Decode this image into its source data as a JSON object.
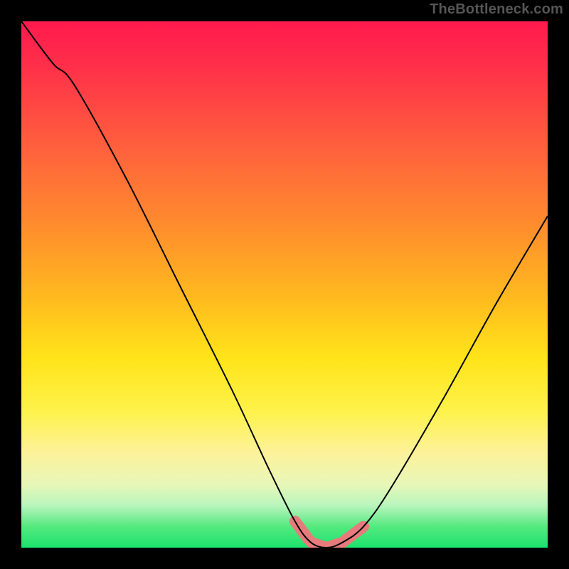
{
  "watermark": "TheBottleneck.com",
  "chart_data": {
    "type": "line",
    "title": "",
    "xlabel": "",
    "ylabel": "",
    "xlim": [
      0,
      100
    ],
    "ylim": [
      0,
      100
    ],
    "grid": false,
    "legend": null,
    "series": [
      {
        "name": "bottleneck-curve",
        "x": [
          0,
          6,
          10,
          20,
          30,
          40,
          47,
          52,
          55,
          58,
          61,
          65,
          70,
          80,
          90,
          100
        ],
        "values": [
          100,
          92,
          88,
          70,
          50,
          30,
          15,
          5,
          1,
          0,
          1,
          4,
          11,
          28,
          46,
          63
        ]
      }
    ],
    "highlight_segment": {
      "name": "bottleneck-range",
      "x_start": 52,
      "x_end": 65,
      "color": "#e77b7b"
    },
    "background": {
      "type": "vertical-gradient",
      "stops": [
        {
          "pos": 0,
          "color": "#ff1a4d"
        },
        {
          "pos": 50,
          "color": "#ffb81f"
        },
        {
          "pos": 75,
          "color": "#fef24a"
        },
        {
          "pos": 100,
          "color": "#1be36e"
        }
      ]
    }
  }
}
